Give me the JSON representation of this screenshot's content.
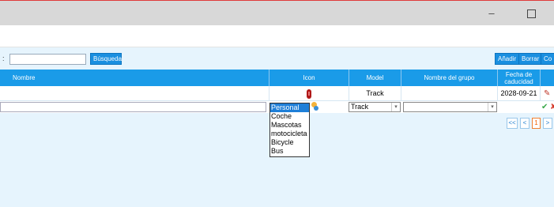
{
  "window": {
    "minimize_glyph": "–",
    "accent_color": "#e03a3a"
  },
  "toolbar": {
    "search_prefix": ":",
    "search_value": "",
    "search_button": "Búsqueda",
    "add_button": "Añadir",
    "delete_button": "Borrar",
    "extra_button": "Co"
  },
  "table": {
    "columns": [
      "Nombre",
      "Icon",
      "Model",
      "Nombre del grupo",
      "Fecha de caducidad",
      ""
    ],
    "rows": [
      {
        "nombre": "",
        "icon": "person-icon",
        "model": "Track",
        "group": "",
        "fecha": "2028-09-21"
      }
    ],
    "edit_row": {
      "nombre_value": "",
      "icon_value": "Personal",
      "model_value": "Track",
      "group_value": ""
    }
  },
  "icon_dropdown": {
    "options": [
      "Personal",
      "Coche",
      "Mascotas",
      "motocicleta",
      "Bicycle",
      "Bus"
    ],
    "selected": "Personal"
  },
  "pager": {
    "first": "<<",
    "prev": "<",
    "current": "1",
    "next": ">"
  },
  "colors": {
    "header_blue": "#1a9be8",
    "button_blue": "#1a8fe0",
    "content_bg": "#e6f4fd"
  }
}
